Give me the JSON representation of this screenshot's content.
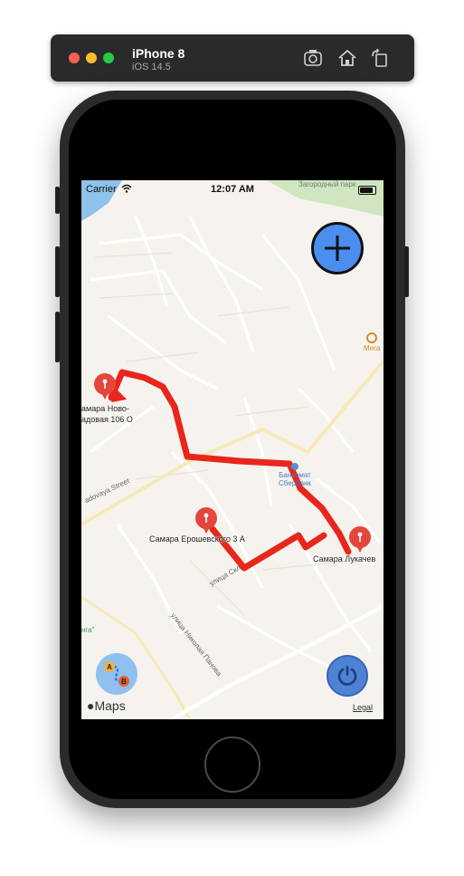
{
  "simulator": {
    "device_name": "iPhone 8",
    "os_version": "iOS 14.5",
    "icons": [
      "screenshot-icon",
      "home-icon",
      "rotate-icon"
    ]
  },
  "status_bar": {
    "carrier": "Carrier",
    "time": "12:07 AM"
  },
  "map": {
    "park_label": "Загородный парк",
    "poi_bank": "Банкомат\nСбербанк",
    "poi_mega": "Мега",
    "streets": [
      "adovaya Street",
      "улица Скл",
      "улица Николая Панова",
      "нга\""
    ],
    "pins": [
      {
        "label": "амара Ново-\nадовая 106 О"
      },
      {
        "label": "Самара Ерошевского 3 А"
      },
      {
        "label": "Самара Лукачев"
      }
    ],
    "route_color": "#e8261c",
    "attribution": "Maps",
    "legal": "Legal"
  },
  "controls": {
    "add_button_icon": "plus-icon",
    "route_button_icon": "route-a-b-icon",
    "power_button_icon": "power-icon"
  }
}
